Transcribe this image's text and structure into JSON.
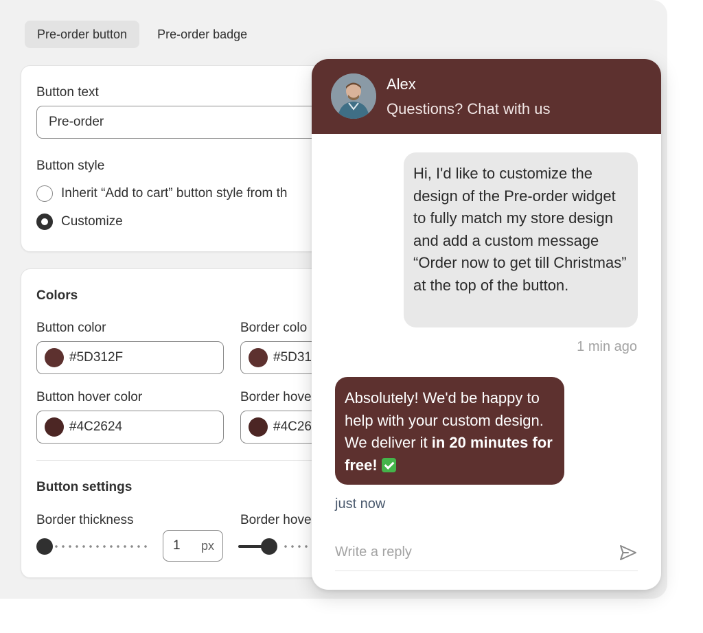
{
  "tabs": [
    {
      "label": "Pre-order button",
      "active": true
    },
    {
      "label": "Pre-order badge",
      "active": false
    }
  ],
  "button_text_section": {
    "label": "Button text",
    "value": "Pre-order",
    "style_label": "Button style",
    "options": [
      {
        "label": "Inherit “Add to cart” button style from th",
        "checked": false
      },
      {
        "label": "Customize",
        "checked": true
      }
    ]
  },
  "colors_section": {
    "heading": "Colors",
    "button_color_label": "Button color",
    "button_color_value": "#5D312F",
    "border_color_label": "Border colo",
    "border_color_value": "#5D31",
    "button_hover_label": "Button hover color",
    "button_hover_value": "#4C2624",
    "border_hover_label": "Border hove",
    "border_hover_value": "#4C26",
    "swatch_colors": {
      "primary": "#5d312f",
      "hover": "#4c2624"
    }
  },
  "button_settings": {
    "heading": "Button settings",
    "border_thickness_label": "Border thickness",
    "border_thickness_value": "1",
    "unit": "px",
    "border_hover_label": "Border hove"
  },
  "chat": {
    "agent_name": "Alex",
    "subtitle": "Questions? Chat with us",
    "outgoing_message": "Hi, I'd like to customize the design of the Pre-order widget to fully match my store design and add a custom message “Order now to get till Christmas” at the top of the button.",
    "outgoing_time": "1 min ago",
    "incoming_message_plain": "Absolutely! We'd be happy to help with your custom design. We deliver it ",
    "incoming_message_bold": "in 20 minutes for free!",
    "incoming_time": "just now",
    "reply_placeholder": "Write a reply",
    "header_color": "#5d312f"
  }
}
